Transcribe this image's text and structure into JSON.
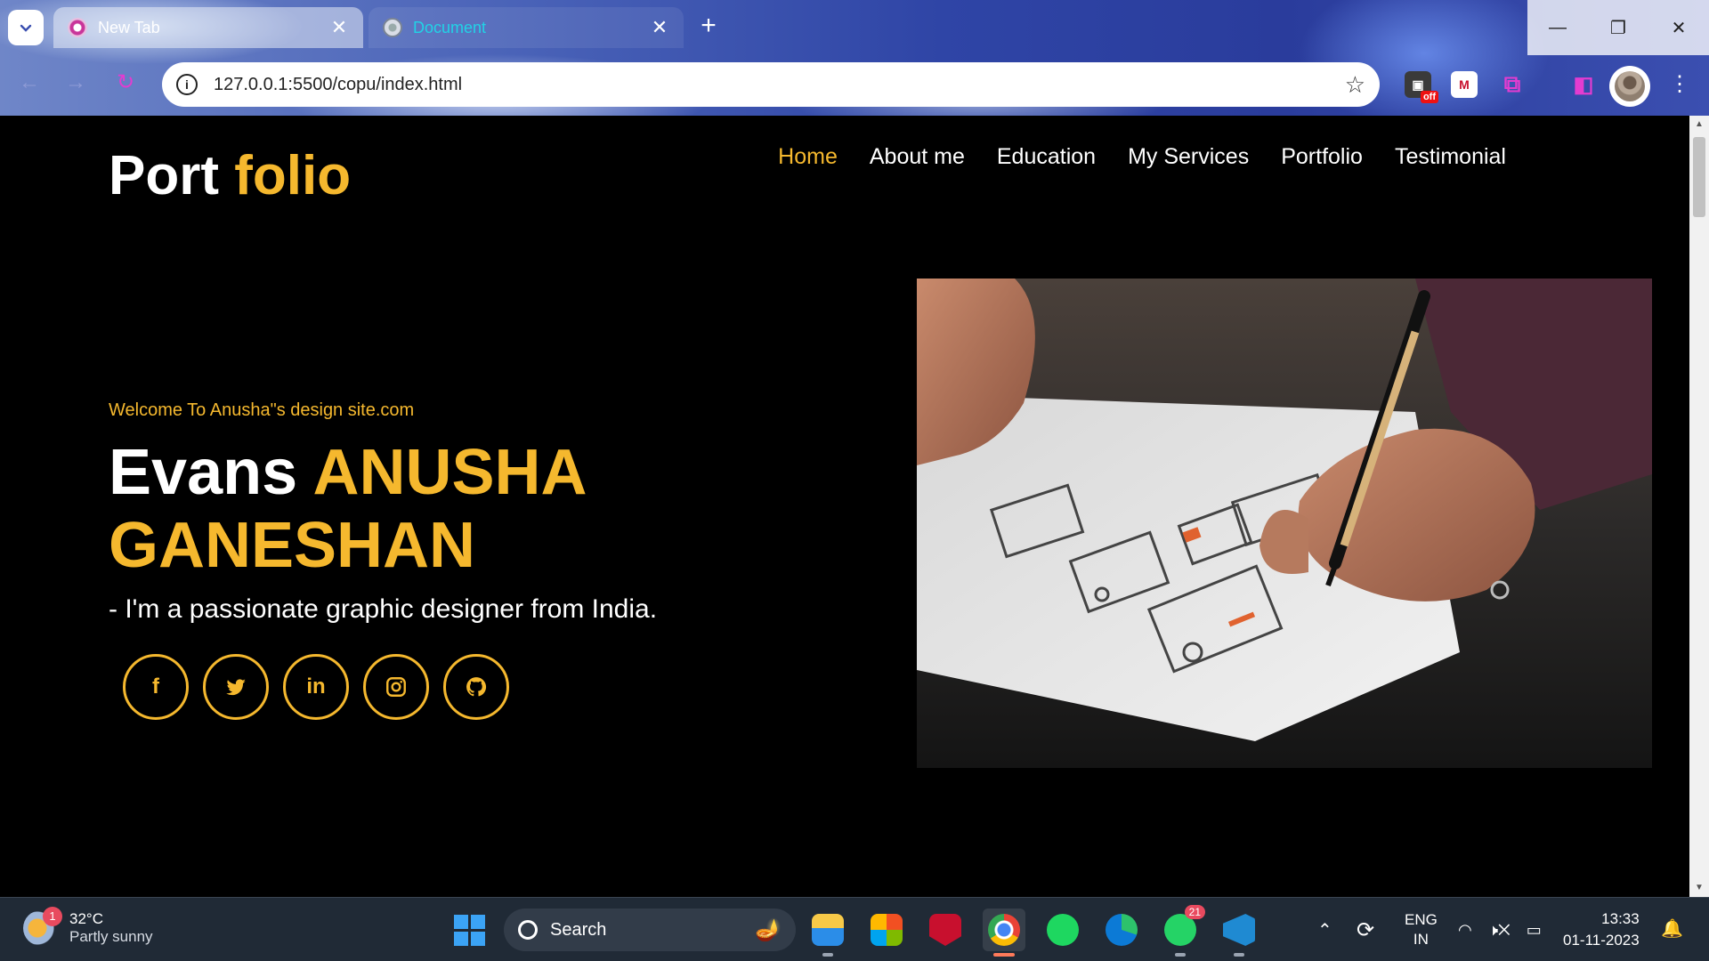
{
  "browser": {
    "tabs": [
      {
        "title": "New Tab",
        "active": false
      },
      {
        "title": "Document",
        "active": true
      }
    ],
    "new_tab_icon": "plus-icon",
    "url": "127.0.0.1:5500/copu/index.html",
    "extensions": {
      "off_badge": "off"
    },
    "window_controls": {
      "minimize": "—",
      "restore": "❐",
      "close": "✕"
    }
  },
  "page": {
    "logo": {
      "part1": "Port",
      "part2": "folio"
    },
    "nav": [
      {
        "label": "Home",
        "active": true
      },
      {
        "label": "About me",
        "active": false
      },
      {
        "label": "Education",
        "active": false
      },
      {
        "label": "My Services",
        "active": false
      },
      {
        "label": "Portfolio",
        "active": false
      },
      {
        "label": "Testimonial",
        "active": false
      }
    ],
    "welcome": "Welcome To Anusha\"s design site.com",
    "headline": {
      "first": "Evans",
      "name": "ANUSHA GANESHAN"
    },
    "tagline": "- I'm a passionate graphic designer from India.",
    "socials": [
      "facebook-icon",
      "twitter-icon",
      "linkedin-icon",
      "instagram-icon",
      "github-icon"
    ],
    "colors": {
      "accent": "#f5b82e",
      "background": "#000000",
      "text": "#ffffff"
    }
  },
  "taskbar": {
    "weather": {
      "badge": "1",
      "temp": "32°C",
      "condition": "Partly sunny"
    },
    "search_label": "Search",
    "whatsapp_badge": "21",
    "lang": {
      "line1": "ENG",
      "line2": "IN"
    },
    "clock": {
      "time": "13:33",
      "date": "01-11-2023"
    }
  }
}
